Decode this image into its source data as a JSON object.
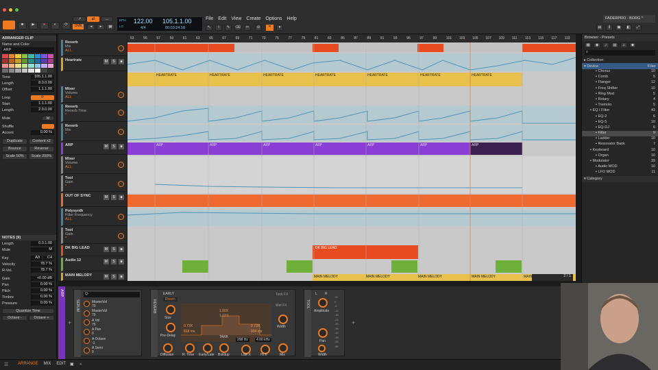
{
  "window": {
    "dots": [
      "#ee5b4f",
      "#f5bd3f",
      "#5fc34a"
    ],
    "project": "FADERPRO - BORG *"
  },
  "menu": [
    "File",
    "Edit",
    "View",
    "Create",
    "Options",
    "Help"
  ],
  "transport": {
    "ovr": "OVR",
    "tempo": "122.00",
    "sig": "4/4",
    "pos": "105.1.1.00",
    "time": "00:03:24.58",
    "bpm_label": "BPM",
    "lo_label": "LO"
  },
  "inspector": {
    "title": "ARRANGER CLIP",
    "name_label": "Name and Color",
    "clip_name": "ARP",
    "palette": [
      "#e04848",
      "#e8852a",
      "#ecc83b",
      "#8bc34a",
      "#3fb8a4",
      "#2b8fd6",
      "#7a5ad6",
      "#d04fa8",
      "#a53030",
      "#b8651d",
      "#c3a12a",
      "#62962f",
      "#25907d",
      "#1f6ca3",
      "#5b3fa8",
      "#a83b86",
      "#f29090",
      "#f4b47f",
      "#f3e08a",
      "#bfe28c",
      "#8fe0d3",
      "#8cc7f0",
      "#c2adf0",
      "#f0a4d9",
      "#6b6b6b",
      "#8a8a8a",
      "#a8a8a8",
      "#c8c8c8",
      "#e0e0e0",
      "#f4f4f4",
      "#454545",
      "#2f2f2f"
    ],
    "fields": [
      {
        "k": "Time",
        "v": "105.1.1.00"
      },
      {
        "k": "Length",
        "v": "8.0.0.00"
      },
      {
        "k": "Offset",
        "v": "1.1.1.00"
      }
    ],
    "loop": {
      "k": "Loop",
      "start_k": "Start",
      "start": "1.1.1.00",
      "len_k": "Length",
      "len": "2.0.0.00"
    },
    "mute": {
      "k": "Mute",
      "v": "M"
    },
    "shuffle": {
      "k": "Shuffle"
    },
    "accent": {
      "k": "Accent",
      "v": "0.00 %"
    },
    "buttons": [
      "Duplicate",
      "Content x2",
      "Bounce",
      "Reverse",
      "Scale 50%",
      "Scale 200%"
    ],
    "notes_title": "NOTES (9)",
    "note_fields": [
      {
        "k": "Length",
        "v": "0.0.1.00"
      },
      {
        "k": "Mute",
        "v": "M"
      }
    ],
    "key": {
      "k": "Key",
      "a": "A3",
      "b": "C4"
    },
    "velocity": [
      {
        "k": "Velocity",
        "v": "78.7 %"
      },
      {
        "k": "R-Vel.",
        "v": "78.7 %"
      }
    ],
    "expr": [
      {
        "k": "Gain",
        "v": "+0.00 dB"
      },
      {
        "k": "Pan",
        "v": "0.00 %"
      },
      {
        "k": "Pitch",
        "v": "0.00 %"
      },
      {
        "k": "Timbre",
        "v": "0.00 %"
      },
      {
        "k": "Pressure",
        "v": "0.00 %"
      }
    ],
    "quantize": "Quantize Time",
    "octave": [
      "Octave -",
      "Octave +"
    ]
  },
  "tracks": [
    {
      "t": "Reverb",
      "s": "Mix",
      "a": "ALL"
    },
    {
      "t": "Heartrate",
      "s": "",
      "a": ""
    },
    {
      "t": "Mixer",
      "s": "Volume",
      "a": "ALL"
    },
    {
      "t": "Reverb",
      "s": "Reverb Time",
      "a": "*"
    },
    {
      "t": "Reverb",
      "s": "Mix",
      "a": "*"
    },
    {
      "t": "ARP",
      "s": "",
      "a": ""
    },
    {
      "t": "Mixer",
      "s": "Volume",
      "a": "ALL"
    },
    {
      "t": "Tool",
      "s": "Gain",
      "a": "*"
    },
    {
      "t": "OUT OF SYNC",
      "s": "",
      "a": ""
    },
    {
      "t": "Polysynth",
      "s": "Filter Frequency",
      "a": "ALL"
    },
    {
      "t": "Tool",
      "s": "Gain",
      "a": "*"
    },
    {
      "t": "DK BIG LEAD",
      "s": "",
      "a": ""
    },
    {
      "t": "Audio 12",
      "s": "",
      "a": ""
    },
    {
      "t": "MAIN MELODY",
      "s": "",
      "a": ""
    }
  ],
  "ruler": [
    "53",
    "55",
    "57",
    "59",
    "61",
    "63",
    "65",
    "67",
    "69",
    "71",
    "73",
    "75",
    "77",
    "79",
    "81",
    "83",
    "85",
    "87",
    "89",
    "91",
    "93",
    "95",
    "97",
    "99",
    "101",
    "103",
    "105",
    "107",
    "109",
    "111",
    "113",
    "115",
    "117",
    "119"
  ],
  "clips": {
    "heartrate": "HEARTRATE",
    "arp": "ARP",
    "dk": "DK BIG LEAD",
    "main": "MAIN MELODY"
  },
  "zoom": "2 / 1",
  "browser": {
    "title": "Browser - Presets",
    "filter": "Filter",
    "collection": "Collection",
    "device": "Device",
    "category": "Category",
    "items": [
      {
        "n": "Chorus",
        "c": "10"
      },
      {
        "n": "Comb",
        "c": "5"
      },
      {
        "n": "Flanger",
        "c": "12"
      },
      {
        "n": "Freq Shifter",
        "c": "10"
      },
      {
        "n": "Ring Mod",
        "c": "5"
      },
      {
        "n": "Rotary",
        "c": "4"
      },
      {
        "n": "Tremolo",
        "c": "5"
      },
      {
        "n": "EQ / Filter",
        "c": "43"
      },
      {
        "n": "EQ-2",
        "c": "6"
      },
      {
        "n": "EQ-5",
        "c": "10"
      },
      {
        "n": "EQ-DJ",
        "c": "6"
      },
      {
        "n": "Filter",
        "c": "9"
      },
      {
        "n": "Ladder",
        "c": "10"
      },
      {
        "n": "Resonator Bank",
        "c": "7"
      },
      {
        "n": "Keyboard",
        "c": "10"
      },
      {
        "n": "Organ",
        "c": "10"
      },
      {
        "n": "Modulator",
        "c": "39"
      },
      {
        "n": "Audio MOD",
        "c": "10"
      },
      {
        "n": "LFO MOD",
        "c": "11"
      }
    ]
  },
  "devices": {
    "track": "ARP",
    "serum": {
      "name": "SERUM",
      "search": "Q-",
      "params": [
        {
          "n": "MasterVol",
          "v": "70"
        },
        {
          "n": "MasterVol",
          "v": "70"
        },
        {
          "n": "A Vol",
          "v": "75"
        },
        {
          "n": "A Pan",
          "v": "0"
        },
        {
          "n": "A Octave",
          "v": "-1"
        },
        {
          "n": "A Semi",
          "v": "0"
        }
      ]
    },
    "reverb": {
      "name": "REVERB",
      "early": "EARLY",
      "room": "Room",
      "size": "Size",
      "predelay": "Pre-Delay",
      "diffusion": "Diffusion",
      "tank": "TANK",
      "rtime": "R. Time",
      "early_late": "Early/Late",
      "buildup": "Buildup",
      "lowx": "Low X",
      "hix": "Hi X",
      "tank_fx": "Tank FX",
      "wet_fx": "Wet FX",
      "width": "Width",
      "mix": "Mix",
      "v1": "0.73X",
      "v2": "818 ms",
      "v3": "1.00X",
      "v4": "1.12:1",
      "v5": "0.73X",
      "v6": "904 ms",
      "low_hz": "298 Hz",
      "hi_hz": "4.00 kHz"
    },
    "tool": {
      "name": "TOOL",
      "amp": "Amplitude",
      "pan": "Pan",
      "width": "Width",
      "l": "L",
      "r": "R"
    }
  },
  "status": {
    "tabs": [
      "ARRANGE",
      "MIX",
      "EDIT"
    ]
  }
}
